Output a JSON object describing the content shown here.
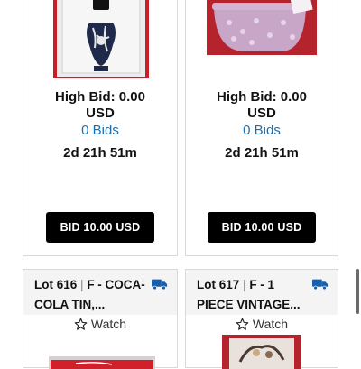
{
  "lots": [
    {
      "high_bid": "High Bid: 0.00",
      "currency": "USD",
      "bids": "0 Bids",
      "time_left": "2d 21h 51m",
      "bid_button": "BID 10.00 USD"
    },
    {
      "high_bid": "High Bid: 0.00",
      "currency": "USD",
      "bids": "0 Bids",
      "time_left": "2d 21h 51m",
      "bid_button": "BID 10.00 USD"
    },
    {
      "lot_number": "Lot 616",
      "title": "F - COCA-COLA TIN,...",
      "watch": "Watch"
    },
    {
      "lot_number": "Lot 617",
      "title": "F - 1 PIECE VINTAGE...",
      "watch": "Watch"
    }
  ],
  "colors": {
    "accent_link": "#1a6fb0",
    "button_bg": "#000000",
    "truck_icon": "#1a5ea8"
  },
  "icons": [
    "truck-icon",
    "star-outline-icon"
  ]
}
